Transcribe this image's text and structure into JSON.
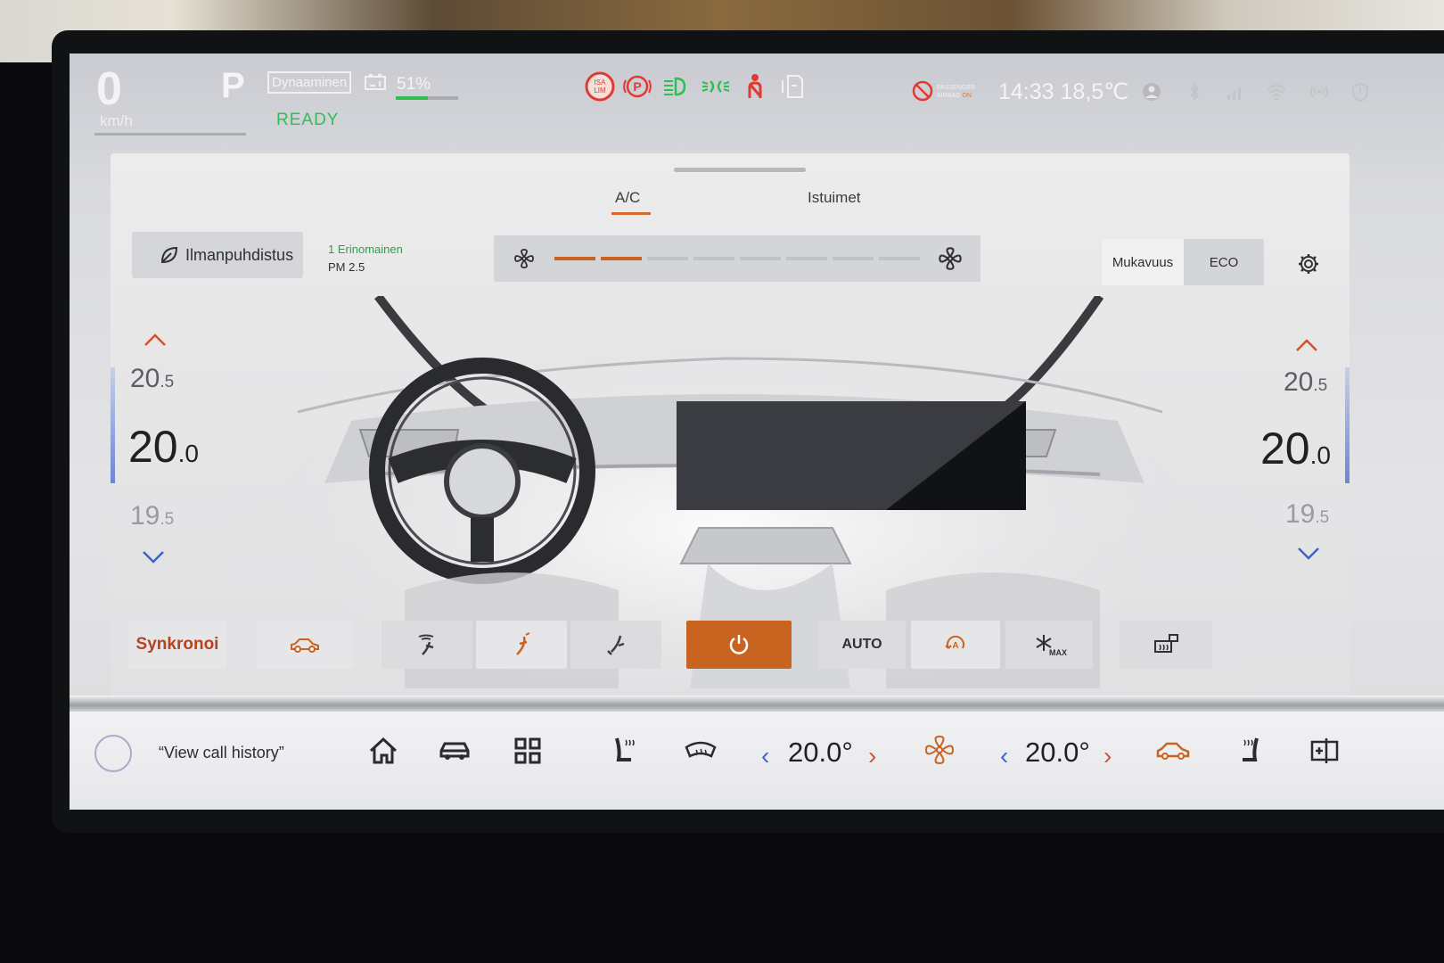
{
  "status_bar": {
    "speed": "0",
    "speed_unit": "km/h",
    "gear": "P",
    "drive_mode": "Dynaaminen",
    "ready": "READY",
    "battery_percent": "51%",
    "battery_level": 0.51,
    "isa_label": "ISA LIM",
    "airbag_label": "PASSENGER AIRBAG ON",
    "clock": "14:33 18,5℃",
    "colors": {
      "ready": "#2fbf52",
      "warning_red": "#e03a33",
      "indicator_green": "#2fbf52"
    }
  },
  "tabs": [
    {
      "label": "A/C",
      "active": true
    },
    {
      "label": "Istuimet",
      "active": false
    }
  ],
  "air_purify": {
    "label": "Ilmanpuhdistus",
    "quality": "1 Erinomainen",
    "pm_label": "PM 2.5"
  },
  "fan": {
    "level": 2,
    "max_level": 8
  },
  "modes": {
    "comfort": "Mukavuus",
    "eco": "ECO",
    "active": "Mukavuus"
  },
  "left_temp": {
    "up": "20",
    "up_dec": ".5",
    "current": "20",
    "current_dec": ".0",
    "down": "19",
    "down_dec": ".5"
  },
  "right_temp": {
    "up": "20",
    "up_dec": ".5",
    "current": "20",
    "current_dec": ".0",
    "down": "19",
    "down_dec": ".5"
  },
  "bottom_row": {
    "sync": "Synkronoi",
    "auto": "AUTO",
    "max": "MAX"
  },
  "dock": {
    "voice_hint": "“View call history”",
    "left_temp": "20.0°",
    "right_temp": "20.0°"
  },
  "accent_color": "#c8641f"
}
